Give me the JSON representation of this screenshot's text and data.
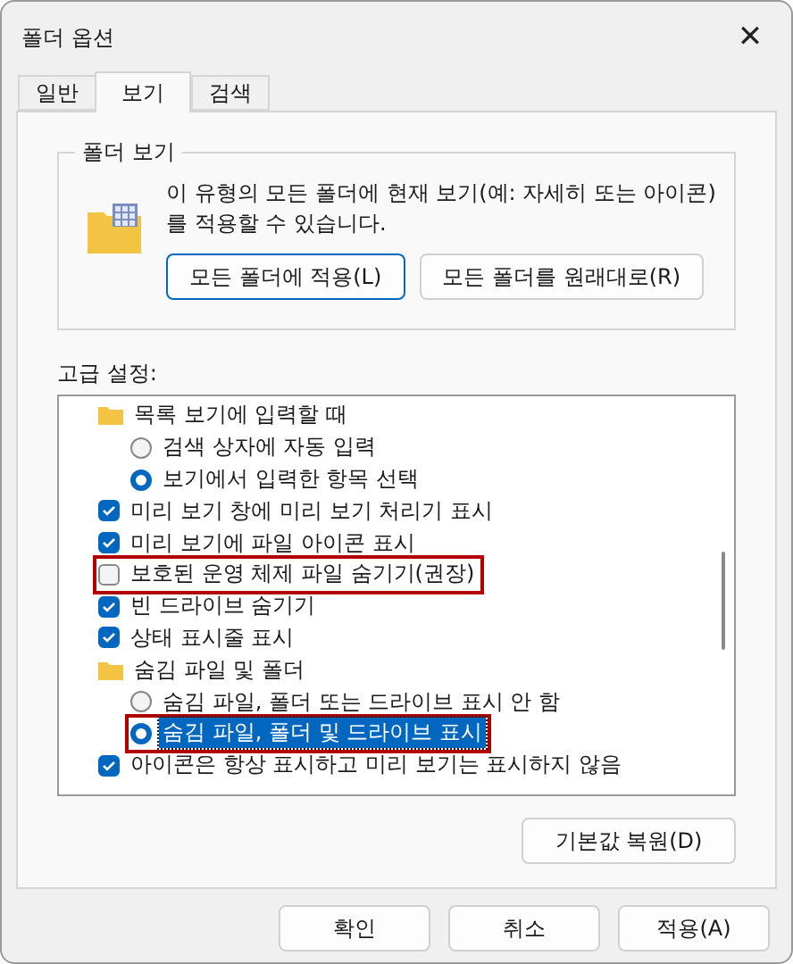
{
  "window": {
    "title": "폴더 옵션",
    "close": "✕"
  },
  "tabs": [
    {
      "label": "일반",
      "selected": false
    },
    {
      "label": "보기",
      "selected": true
    },
    {
      "label": "검색",
      "selected": false
    }
  ],
  "folder_views": {
    "title": "폴더 보기",
    "description": "이 유형의 모든 폴더에 현재 보기(예: 자세히 또는 아이콘)를 적용할 수 있습니다.",
    "buttons": [
      {
        "label": "모든 폴더에 적용(L)",
        "focused": true
      },
      {
        "label": "모든 폴더를 원래대로(R)",
        "focused": false
      }
    ]
  },
  "advanced": {
    "title": "고급 설정:",
    "items": [
      {
        "kind": "folder",
        "label": "목록 보기에 입력할 때",
        "children": [
          {
            "kind": "radio",
            "label": "검색 상자에 자동 입력",
            "selected": false,
            "highlighted": false,
            "focused": false
          },
          {
            "kind": "radio",
            "label": "보기에서 입력한 항목 선택",
            "selected": true,
            "highlighted": false,
            "focused": false
          }
        ]
      },
      {
        "kind": "checkbox",
        "label": "미리 보기 창에 미리 보기 처리기 표시",
        "checked": true,
        "highlighted": false
      },
      {
        "kind": "checkbox",
        "label": "미리 보기에 파일 아이콘 표시",
        "checked": true,
        "highlighted": false
      },
      {
        "kind": "checkbox",
        "label": "보호된 운영 체제 파일 숨기기(권장)",
        "checked": false,
        "highlighted": true
      },
      {
        "kind": "checkbox",
        "label": "빈 드라이브 숨기기",
        "checked": true,
        "highlighted": false
      },
      {
        "kind": "checkbox",
        "label": "상태 표시줄 표시",
        "checked": true,
        "highlighted": false
      },
      {
        "kind": "folder",
        "label": "숨김 파일 및 폴더",
        "children": [
          {
            "kind": "radio",
            "label": "숨김 파일, 폴더 또는 드라이브 표시 안 함",
            "selected": false,
            "highlighted": false,
            "focused": false
          },
          {
            "kind": "radio",
            "label": "숨김 파일, 폴더 및 드라이브 표시",
            "selected": true,
            "highlighted": true,
            "focused": true
          }
        ]
      },
      {
        "kind": "checkbox",
        "label": "아이콘은 항상 표시하고 미리 보기는 표시하지 않음",
        "checked": true,
        "highlighted": false
      }
    ],
    "restore_button": "기본값 복원(D)"
  },
  "buttons": [
    {
      "label": "확인"
    },
    {
      "label": "취소"
    },
    {
      "label": "적용(A)"
    }
  ]
}
